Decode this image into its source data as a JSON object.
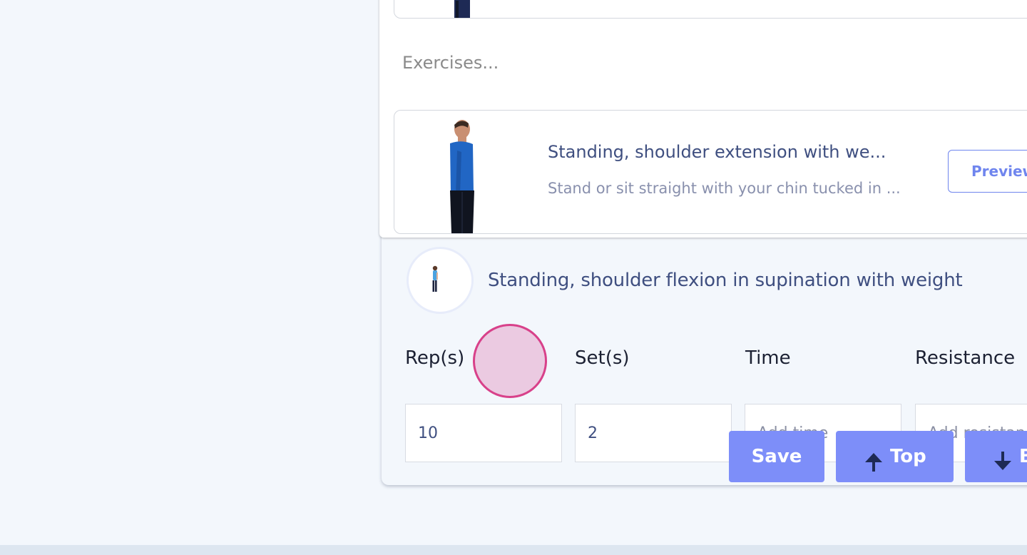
{
  "dropdown": {
    "section_label": "Exercises...",
    "results": [
      {
        "title": "Standing, shoulder extension with we...",
        "description": "Stand or sit straight with your chin tucked in ...",
        "preview_label": "Preview"
      }
    ]
  },
  "workout": {
    "exercise_title": "Standing, shoulder flexion in supination with weight",
    "fields": {
      "reps": {
        "label": "Rep(s)",
        "value": "10"
      },
      "sets": {
        "label": "Set(s)",
        "value": "2"
      },
      "time": {
        "label": "Time",
        "placeholder": "Add time"
      },
      "resistance": {
        "label": "Resistance",
        "placeholder": "Add resistance"
      }
    }
  },
  "actions": {
    "save_label": "Save",
    "top_label": "Top",
    "bottom_label": "Bottom"
  },
  "colors": {
    "accent": "#7d8ef9",
    "title_text": "#3f4f80",
    "page_bg": "#f3f7fc",
    "touch_indicator": "#d8418a"
  }
}
